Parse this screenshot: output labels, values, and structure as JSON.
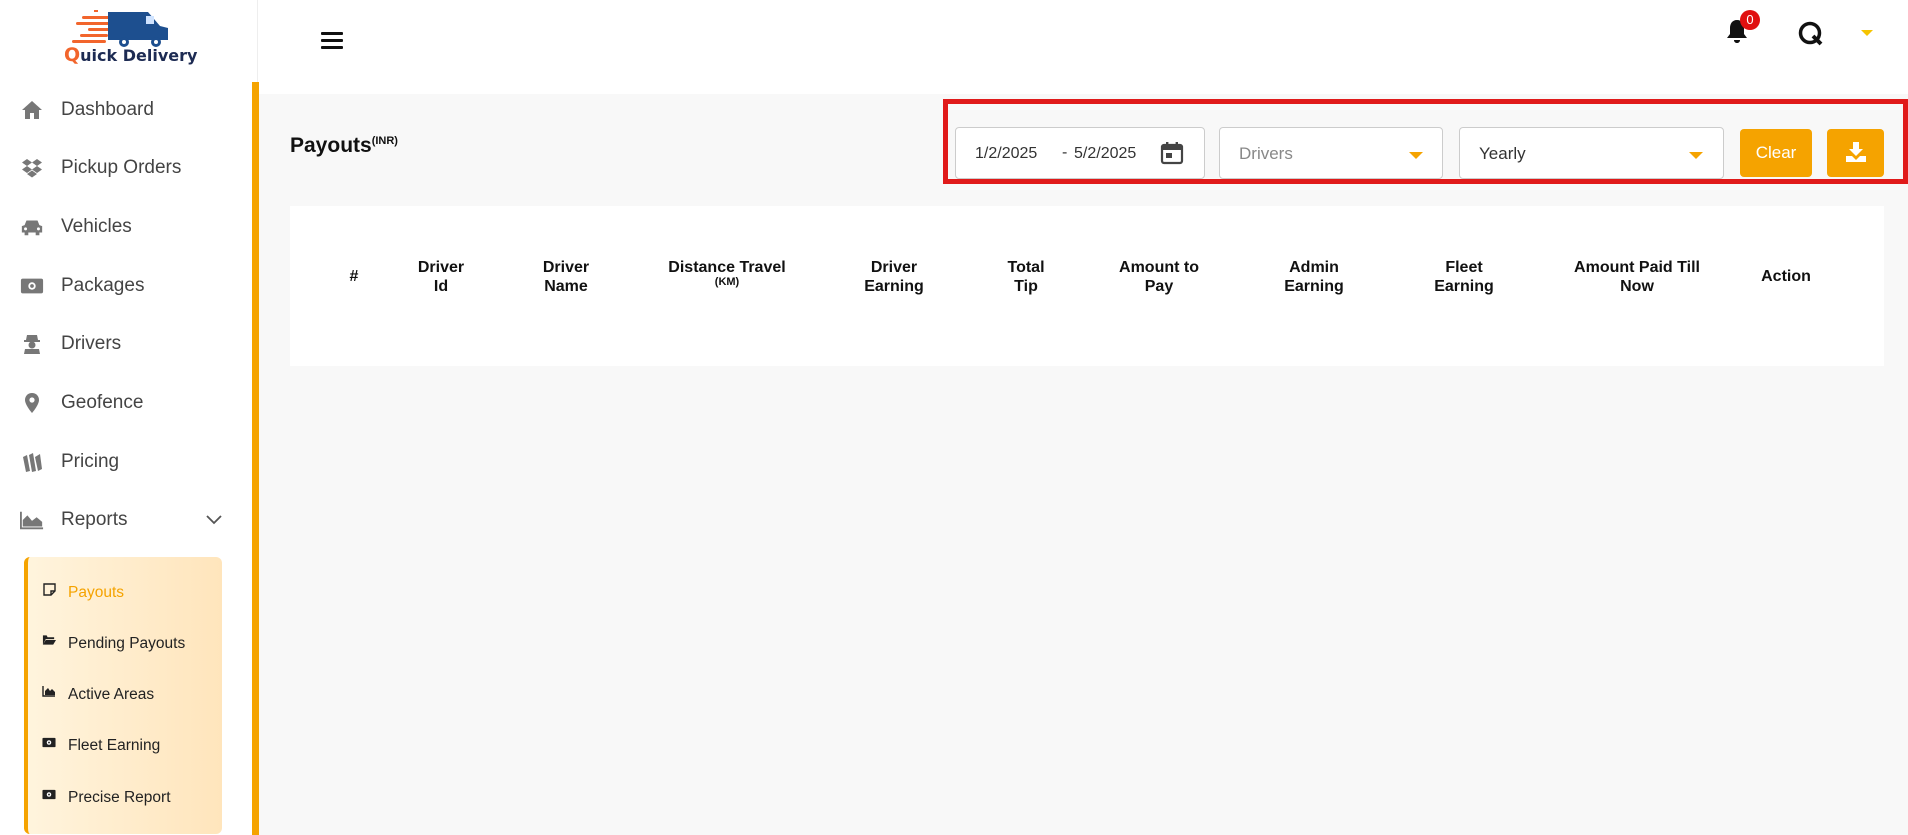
{
  "brand": {
    "q_letter": "Q",
    "rest": "uick Delivery"
  },
  "sidebar": {
    "items": [
      {
        "label": "Dashboard",
        "icon": "home-icon"
      },
      {
        "label": "Pickup Orders",
        "icon": "dropbox-icon"
      },
      {
        "label": "Vehicles",
        "icon": "car-icon"
      },
      {
        "label": "Packages",
        "icon": "money-bill-icon"
      },
      {
        "label": "Drivers",
        "icon": "user-secret-icon"
      },
      {
        "label": "Geofence",
        "icon": "map-pin-icon"
      },
      {
        "label": "Pricing",
        "icon": "pricing-icon"
      },
      {
        "label": "Reports",
        "icon": "area-chart-icon"
      }
    ],
    "reports_submenu": [
      {
        "label": "Payouts",
        "icon": "note-icon",
        "active": true
      },
      {
        "label": "Pending Payouts",
        "icon": "folder-open-icon",
        "active": false
      },
      {
        "label": "Active Areas",
        "icon": "area-chart-icon",
        "active": false
      },
      {
        "label": "Fleet Earning",
        "icon": "money-bill-icon",
        "active": false
      },
      {
        "label": "Precise Report",
        "icon": "money-bill-icon",
        "active": false
      }
    ]
  },
  "header": {
    "notification_count": "0"
  },
  "page": {
    "title": "Payouts",
    "currency": "(INR)"
  },
  "filters": {
    "start_date": "1/2/2025",
    "separator": "-",
    "end_date": "5/2/2025",
    "drivers_placeholder": "Drivers",
    "period_value": "Yearly",
    "clear_label": "Clear"
  },
  "table": {
    "columns": [
      {
        "line1": "#",
        "line2": "",
        "sub": ""
      },
      {
        "line1": "Driver",
        "line2": "Id",
        "sub": ""
      },
      {
        "line1": "Driver",
        "line2": "Name",
        "sub": ""
      },
      {
        "line1": "Distance Travel",
        "line2": "",
        "sub": "(KM)"
      },
      {
        "line1": "Driver",
        "line2": "Earning",
        "sub": ""
      },
      {
        "line1": "Total",
        "line2": "Tip",
        "sub": ""
      },
      {
        "line1": "Amount to",
        "line2": "Pay",
        "sub": ""
      },
      {
        "line1": "Admin",
        "line2": "Earning",
        "sub": ""
      },
      {
        "line1": "Fleet",
        "line2": "Earning",
        "sub": ""
      },
      {
        "line1": "Amount Paid Till",
        "line2": "Now",
        "sub": ""
      },
      {
        "line1": "Action",
        "line2": "",
        "sub": ""
      }
    ]
  },
  "colors": {
    "accent": "#f5a300",
    "highlight": "#e01a1a",
    "badge": "#e01010"
  }
}
